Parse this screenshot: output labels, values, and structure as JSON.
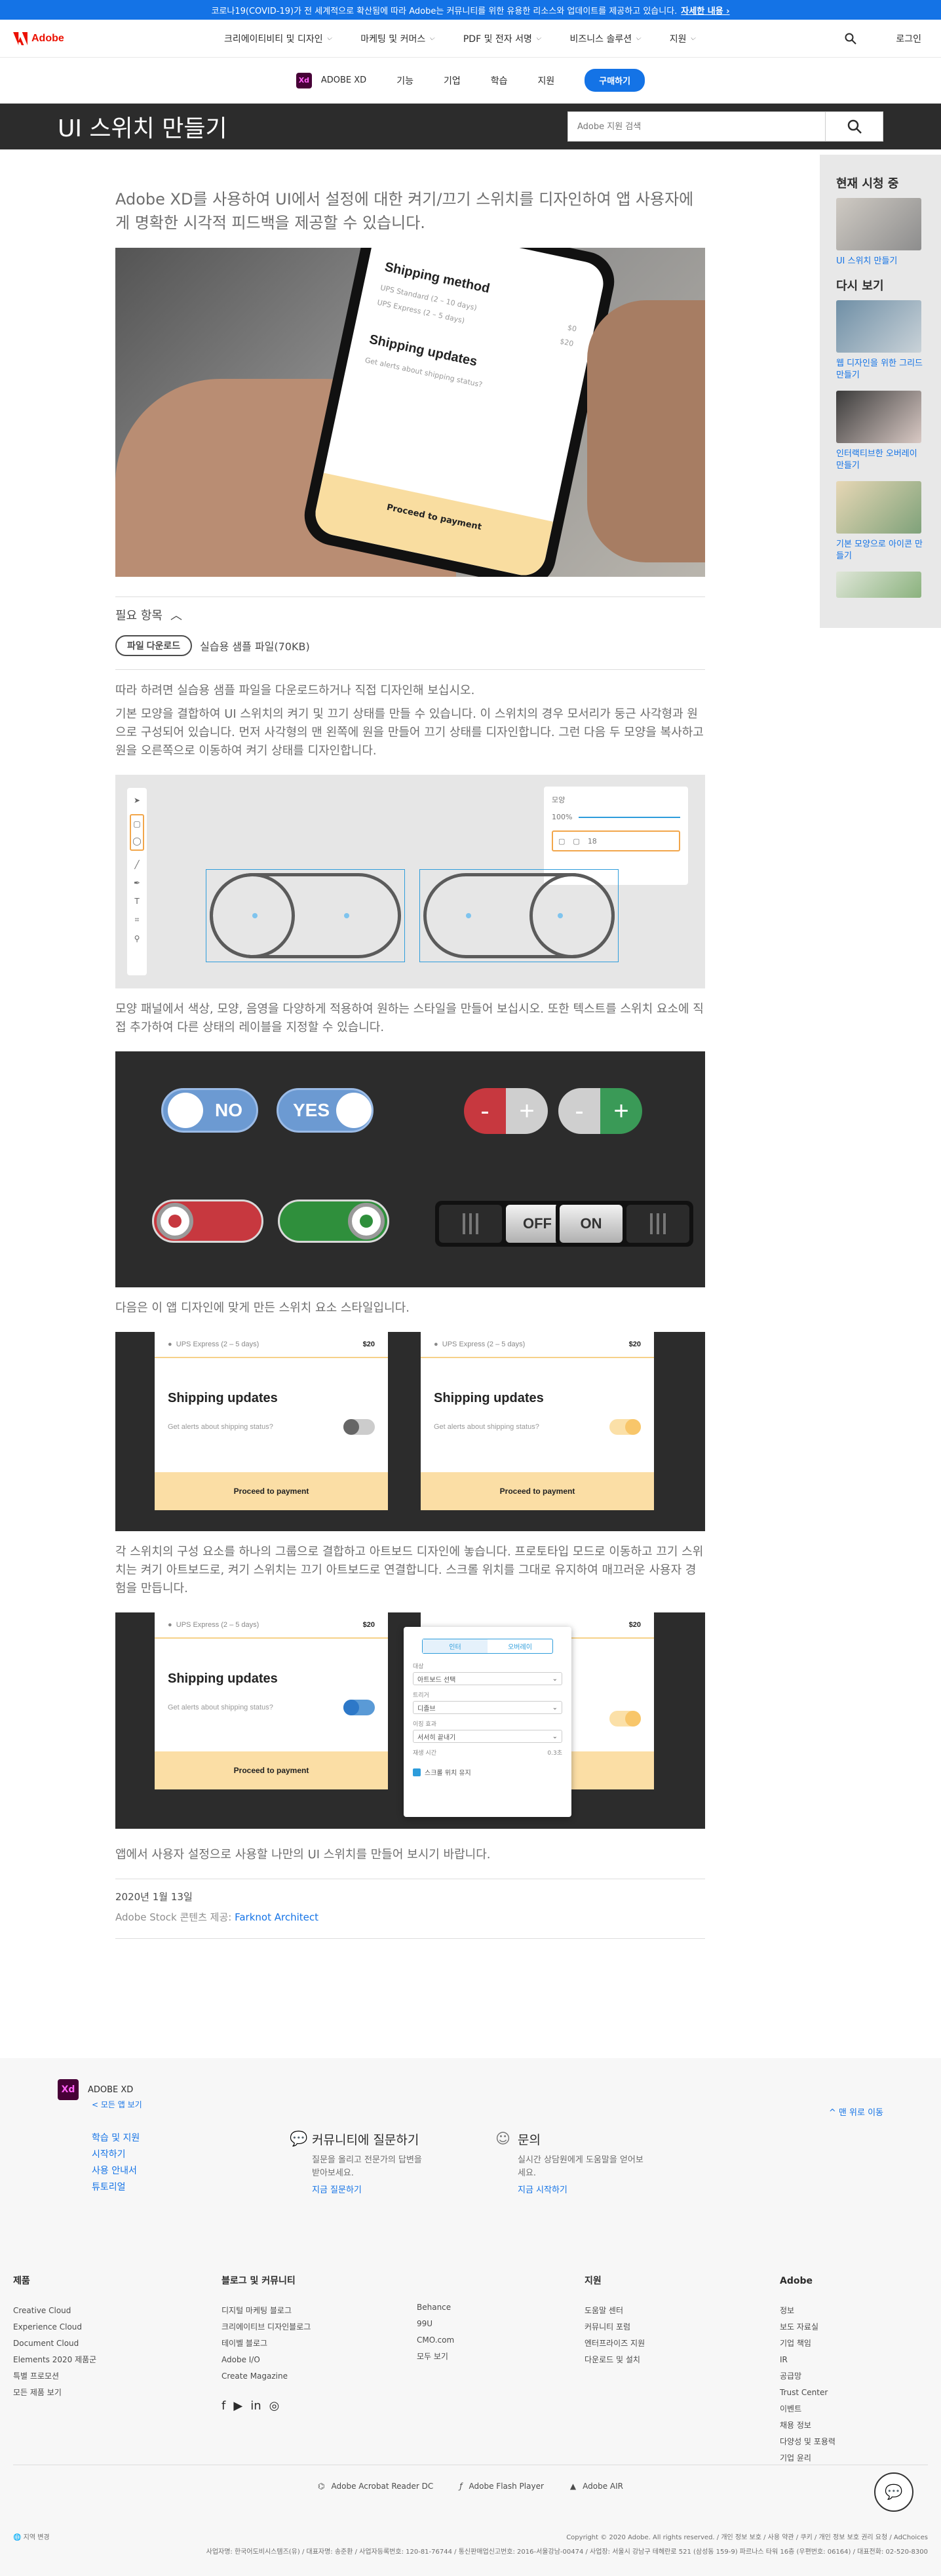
{
  "alert": {
    "text": "코로나19(COVID-19)가 전 세계적으로 확산됨에 따라 Adobe는 커뮤니티를 위한 유용한 리소스와 업데이트를 제공하고 있습니다.",
    "link": "자세한 내용 ›"
  },
  "gnav": {
    "logo": "Adobe",
    "items": [
      "크리에이티비티 및 디자인",
      "마케팅 및 커머스",
      "PDF 및 전자 서명",
      "비즈니스 솔루션",
      "지원"
    ],
    "login": "로그인"
  },
  "pnav": {
    "product": "ADOBE XD",
    "badge": "Xd",
    "items": [
      "기능",
      "기업",
      "학습",
      "지원"
    ],
    "buy": "구매하기"
  },
  "title": "UI 스위치 만들기",
  "search": {
    "placeholder": "Adobe 지원 검색"
  },
  "main": {
    "lead": "Adobe XD를 사용하여 UI에서 설정에 대한 켜기/끄기 스위치를 디자인하여 앱 사용자에게 명확한 시각적 피드백을 제공할 수 있습니다.",
    "hero": {
      "h1": "Shipping method",
      "o1": "UPS Standard (2 – 10 days)",
      "o2": "UPS Express (2 – 5 days)",
      "p2": "$0",
      "p3": "$20",
      "h2": "Shipping updates",
      "q": "Get alerts about shipping status?",
      "cta": "Proceed to payment"
    },
    "req": {
      "head": "필요 항목",
      "button": "파일 다운로드",
      "text": "실습용 샘플 파일(70KB)"
    },
    "p1": "따라 하려면 실습용 샘플 파일을 다운로드하거나 직접 디자인해 보십시오.",
    "p2": "기본 모양을 결합하여 UI 스위치의 켜기 및 끄기 상태를 만들 수 있습니다. 이 스위치의 경우 모서리가 둥근 사각형과 원으로 구성되어 있습니다. 먼저 사각형의 맨 왼쪽에 원을 만들어 끄기 상태를 디자인합니다. 그런 다음 두 모양을 복사하고 원을 오른쪽으로 이동하여 켜기 상태를 디자인합니다.",
    "fig1": {
      "panel_title": "모양",
      "pct": "100%",
      "val": "18"
    },
    "p3": "모양 패널에서 색상, 모양, 음영을 다양하게 적용하여 원하는 스타일을 만들어 보십시오. 또한 텍스트를 스위치 요소에 직접 추가하여 다른 상태의 레이블을 지정할 수 있습니다.",
    "fig2": {
      "no": "NO",
      "yes": "YES",
      "minus": "-",
      "plus": "+",
      "off": "OFF",
      "on": "ON"
    },
    "p4": "다음은 이 앱 디자인에 맞게 만든 스위치 요소 스타일입니다.",
    "card": {
      "opt": "UPS Express (2 – 5 days)",
      "price": "$20",
      "h": "Shipping updates",
      "q": "Get alerts about shipping status?",
      "cta": "Proceed to payment"
    },
    "p5": "각 스위치의 구성 요소를 하나의 그룹으로 결합하고 아트보드 디자인에 놓습니다. 프로토타입 모드로 이동하고 끄기 스위치는 켜기 아트보드로, 켜기 스위치는 끄기 아트보드로 연결합니다. 스크롤 위치를 그대로 유지하여 매끄러운 사용자 경험을 만듭니다.",
    "pi": {
      "tab1": "인터",
      "tab2": "오버레이",
      "l1": "대상",
      "v1": "아트보드 선택",
      "l2": "트리거",
      "v2": "디졸브",
      "l3": "이징 효과",
      "v3": "서서히 끝내기",
      "l4": "재생 시간",
      "v4": "0.3초",
      "chk": "스크롤 위치 유지"
    },
    "p6": "앱에서 사용자 설정으로 사용할 나만의 UI 스위치를 만들어 보시기 바랍니다.",
    "date": "2020년 1월 13일",
    "credit_prefix": "Adobe Stock 콘텐츠 제공:",
    "credit_name": "Farknot Architect"
  },
  "rail": {
    "now": "현재 시청 중",
    "now_items": [
      "UI 스위치 만들기"
    ],
    "again": "다시 보기",
    "items": [
      "웹 디자인을 위한 그리드 만들기",
      "인터랙티브한 오버레이 만들기",
      "기본 모양으로 아이콘 만들기"
    ]
  },
  "footer": {
    "product": "ADOBE XD",
    "all": "< 모든 앱 보기",
    "top": "^ 맨 위로 이동",
    "links": [
      "학습 및 지원",
      "시작하기",
      "사용 안내서",
      "튜토리얼"
    ],
    "community": {
      "title": "커뮤니티에 질문하기",
      "desc": "질문을 올리고 전문가의 답변을 받아보세요.",
      "link": "지금 질문하기"
    },
    "contact": {
      "title": "문의",
      "desc": "실시간 상담원에게 도움말을 얻어보세요.",
      "link": "지금 시작하기"
    },
    "cols": [
      {
        "h": "제품",
        "items": [
          "Creative Cloud",
          "Experience Cloud",
          "Document Cloud",
          "Elements 2020 제품군",
          "특별 프로모션",
          "모든 제품 보기"
        ]
      },
      {
        "h": "블로그 및 커뮤니티",
        "items": [
          "디지털 마케팅 블로그",
          "크리에이티브 디자인블로그",
          "테이벨 블로그",
          "Adobe I/O",
          "Create Magazine"
        ]
      },
      {
        "h": "",
        "items": [
          "Behance",
          "99U",
          "CMO.com",
          "모두 보기"
        ]
      },
      {
        "h": "지원",
        "items": [
          "도움말 센터",
          "커뮤니티 포럼",
          "엔터프라이즈 지원",
          "다운로드 및 설치"
        ]
      },
      {
        "h": "Adobe",
        "items": [
          "정보",
          "보도 자료실",
          "기업 책임",
          "IR",
          "공급망",
          "Trust Center",
          "이벤트",
          "채용 정보",
          "다양성 및 포용력",
          "기업 윤리"
        ]
      }
    ],
    "apps": [
      "Adobe Acrobat Reader DC",
      "Adobe Flash Player",
      "Adobe AIR"
    ],
    "region": "지역 변경",
    "copyright": "Copyright © 2020 Adobe. All rights reserved.  /  개인 정보 보호  /  사용 약관  /  쿠키  /  개인 정보 보호 권리 요청  /  AdChoices",
    "legal": "사업자명: 한국어도비시스템즈(유) / 대표자명: 송준환 / 사업자등록번호: 120-81-76744 / 통신판매업신고번호: 2016-서울강남-00474 / 사업장: 서울시 강남구 테헤란로 521 (삼성동 159-9) 파르나스 타워 16층 (우편번호: 06164) / 대표전화: 02-520-8300"
  }
}
